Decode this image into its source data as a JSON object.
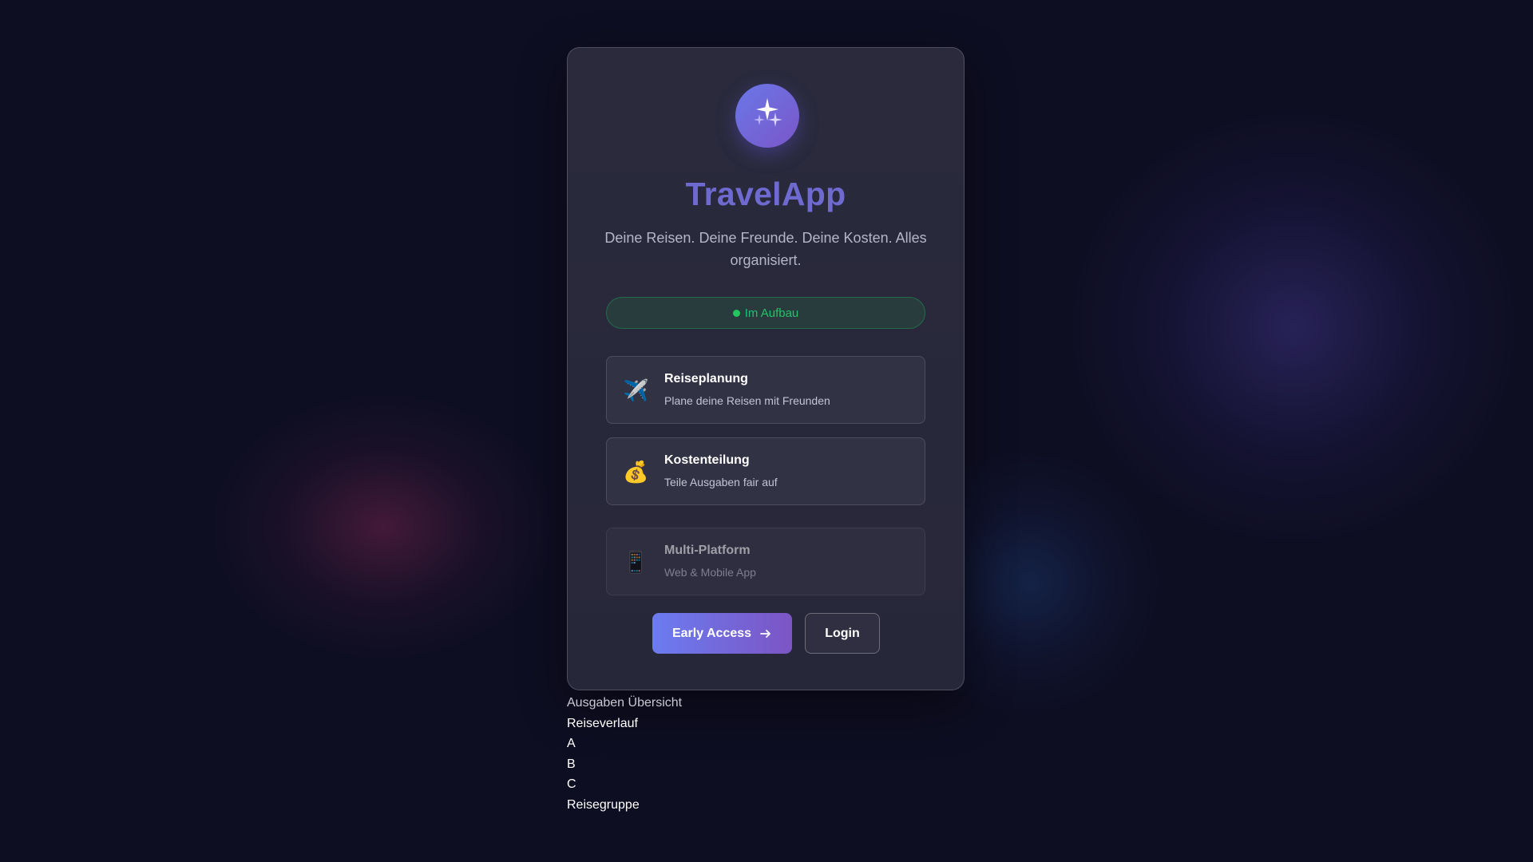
{
  "app": {
    "title": "TravelApp",
    "tagline": "Deine Reisen. Deine Freunde. Deine Kosten. Alles organisiert.",
    "logo_icon": "sparkles-icon",
    "brand_color": "#6e6ad0"
  },
  "status": {
    "label": "Im Aufbau",
    "color": "#22c55e"
  },
  "features": [
    {
      "icon": "airplane-icon",
      "glyph": "✈️",
      "title": "Reiseplanung",
      "description": "Plane deine Reisen mit Freunden"
    },
    {
      "icon": "money-bag-icon",
      "glyph": "💰",
      "title": "Kostenteilung",
      "description": "Teile Ausgaben fair auf"
    },
    {
      "icon": "mobile-phone-icon",
      "glyph": "📱",
      "title": "Multi-Platform",
      "description": "Web & Mobile App"
    }
  ],
  "actions": {
    "primary_label": "Early Access",
    "secondary_label": "Login"
  },
  "footer_links": [
    "Ausgaben Übersicht",
    "Reiseverlauf",
    "A",
    "B",
    "C",
    "Reisegruppe"
  ]
}
